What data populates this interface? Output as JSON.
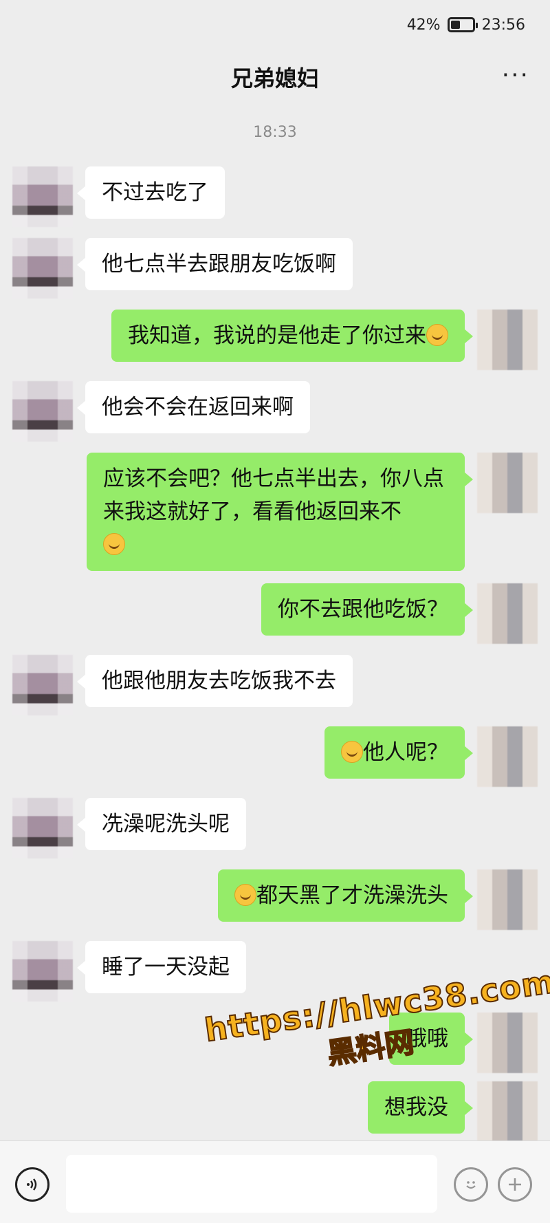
{
  "status": {
    "battery": "42%",
    "time": "23:56"
  },
  "header": {
    "title": "兄弟媳妇",
    "more": "···"
  },
  "timestamp": "18:33",
  "messages": [
    {
      "side": "left",
      "text": "不过去吃了"
    },
    {
      "side": "left",
      "text": "他七点半去跟朋友吃饭啊"
    },
    {
      "side": "right",
      "text": "我知道，我说的是他走了你过来",
      "emoji_after": "grinning-face-icon"
    },
    {
      "side": "left",
      "text": "他会不会在返回来啊"
    },
    {
      "side": "right",
      "text": "应该不会吧？他七点半出去，你八点来我这就好了，看看他返回来不",
      "emoji_after": "flushed-face-icon"
    },
    {
      "side": "right",
      "text": "你不去跟他吃饭？"
    },
    {
      "side": "left",
      "text": "他跟他朋友去吃饭我不去"
    },
    {
      "side": "right",
      "text": "他人呢？",
      "emoji_before": "grimacing-face-icon"
    },
    {
      "side": "left",
      "text": "冼澡呢洗头呢"
    },
    {
      "side": "right",
      "text": "都天黑了才洗澡洗头",
      "emoji_before": "rolling-laughing-face-icon"
    },
    {
      "side": "left",
      "text": "睡了一天没起"
    },
    {
      "side": "right",
      "text": "哦哦"
    },
    {
      "side": "right",
      "text": "想我没"
    }
  ],
  "input": {
    "placeholder": ""
  },
  "watermark": {
    "url": "https://hlwc38.com",
    "name": "黑料网"
  }
}
